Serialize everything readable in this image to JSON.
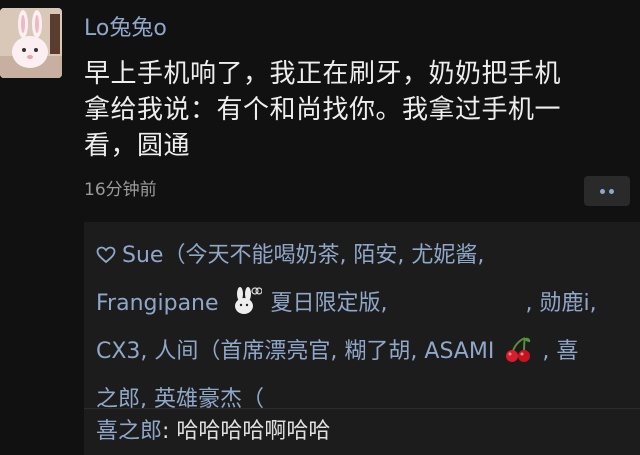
{
  "post": {
    "username": "Lo兔兔o",
    "text_lines": [
      "早上手机响了，我正在刷牙，奶奶把手机",
      "拿给我说：有个和尚找你。我拿过手机一",
      "看，圆通"
    ],
    "time": "16分钟前"
  },
  "likes": {
    "rows": [
      [
        "Sue（今天不能喝奶茶, 陌安, 尤妮酱,"
      ],
      [
        "Frangipane",
        "夏日限定版,",
        ", 勋鹿i,"
      ],
      [
        "CX3, 人间（首席漂亮官, 糊了胡, ASAMI",
        ", 喜"
      ],
      [
        "之郎, 英雄豪杰（"
      ]
    ]
  },
  "comments": [
    {
      "author": "喜之郎",
      "text": ": 哈哈哈哈啊哈哈"
    }
  ],
  "colors": {
    "background": "#111111",
    "panel": "#1c1c1c",
    "link": "#8fa7c8",
    "text": "#eeeeee",
    "muted": "#9a9a9a"
  },
  "icons": {
    "like": "heart-outline-icon",
    "more": "more-dots-icon",
    "emoji_1": "rabbit-emoji-icon",
    "emoji_2": "cherry-emoji-icon"
  }
}
